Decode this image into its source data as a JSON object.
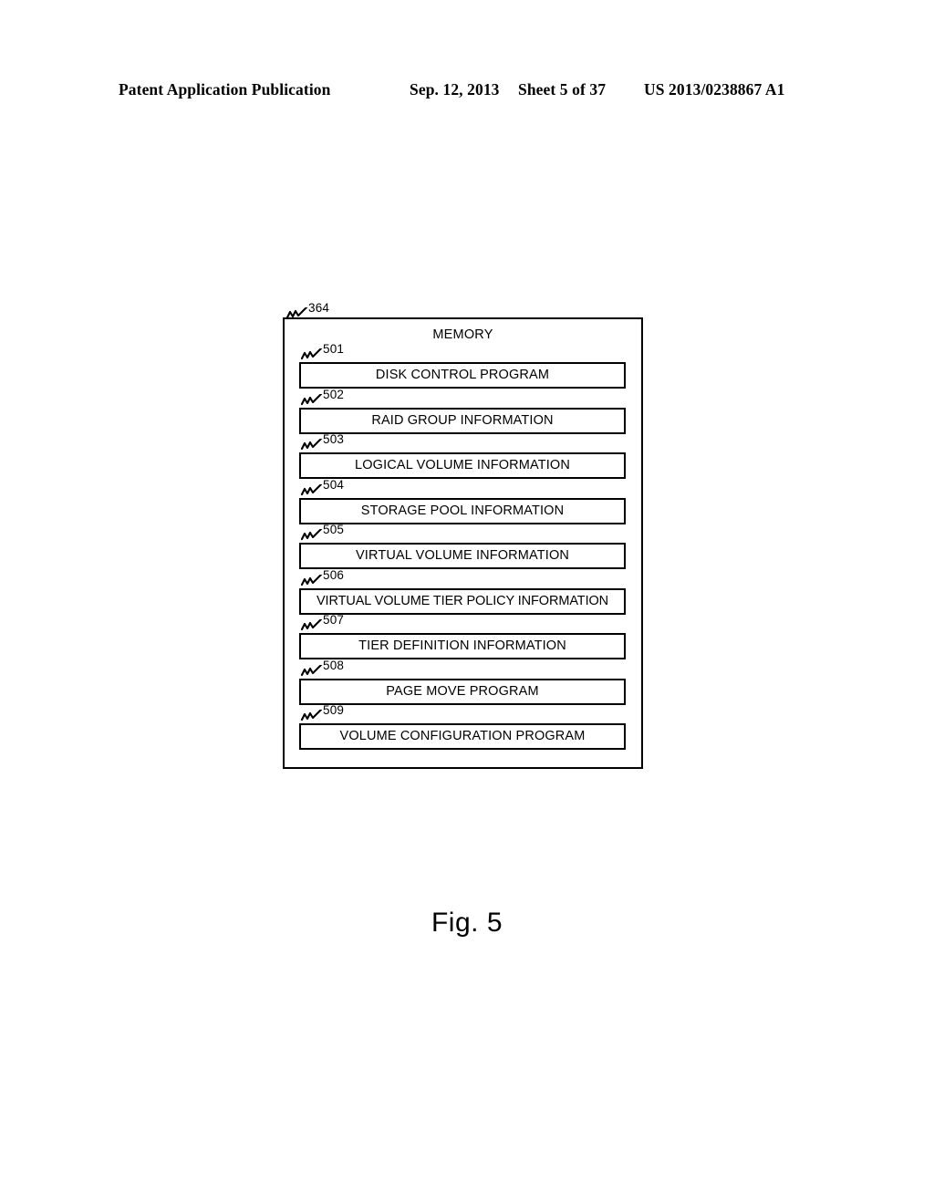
{
  "header": {
    "publication": "Patent Application Publication",
    "date": "Sep. 12, 2013",
    "sheet": "Sheet 5 of 37",
    "patent_number": "US 2013/0238867 A1"
  },
  "figure": {
    "caption": "Fig. 5",
    "outer": {
      "ref": "364",
      "title": "MEMORY"
    },
    "components": [
      {
        "ref": "501",
        "label": "DISK CONTROL PROGRAM"
      },
      {
        "ref": "502",
        "label": "RAID GROUP INFORMATION"
      },
      {
        "ref": "503",
        "label": "LOGICAL VOLUME INFORMATION"
      },
      {
        "ref": "504",
        "label": "STORAGE POOL INFORMATION"
      },
      {
        "ref": "505",
        "label": "VIRTUAL VOLUME INFORMATION"
      },
      {
        "ref": "506",
        "label": "VIRTUAL VOLUME TIER POLICY INFORMATION"
      },
      {
        "ref": "507",
        "label": "TIER DEFINITION INFORMATION"
      },
      {
        "ref": "508",
        "label": "PAGE MOVE PROGRAM"
      },
      {
        "ref": "509",
        "label": "VOLUME CONFIGURATION PROGRAM"
      }
    ]
  }
}
